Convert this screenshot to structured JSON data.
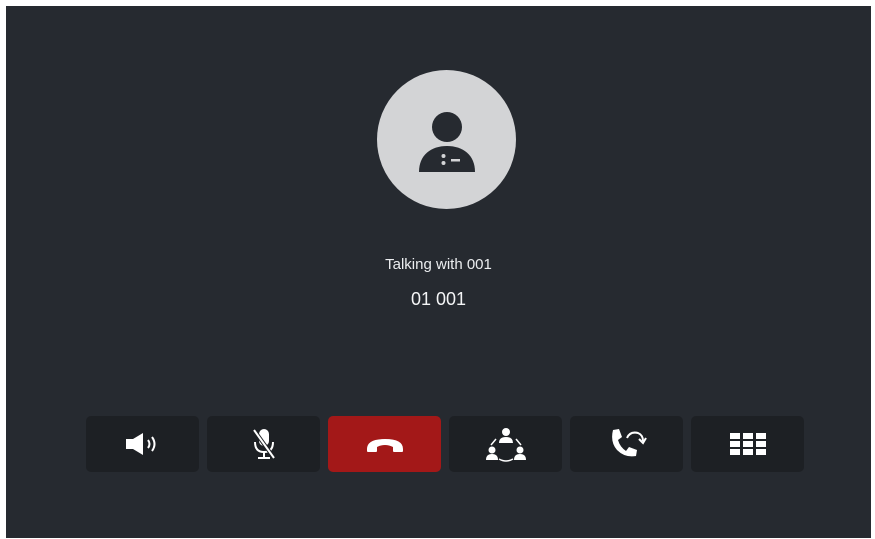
{
  "call": {
    "status": "Talking with 001",
    "number": "01 001"
  },
  "avatar": {
    "icon": "person-icon"
  },
  "controls": [
    {
      "name": "speaker-button",
      "icon": "speaker-icon"
    },
    {
      "name": "mute-button",
      "icon": "microphone-muted-icon"
    },
    {
      "name": "hangup-button",
      "icon": "hangup-icon",
      "color": "#a31818"
    },
    {
      "name": "conference-button",
      "icon": "conference-icon"
    },
    {
      "name": "transfer-button",
      "icon": "call-transfer-icon"
    },
    {
      "name": "keypad-button",
      "icon": "keypad-icon"
    }
  ],
  "colors": {
    "background": "#262a30",
    "button": "#1d2024",
    "hangup": "#a31818",
    "avatar_bg": "#d3d4d6"
  }
}
